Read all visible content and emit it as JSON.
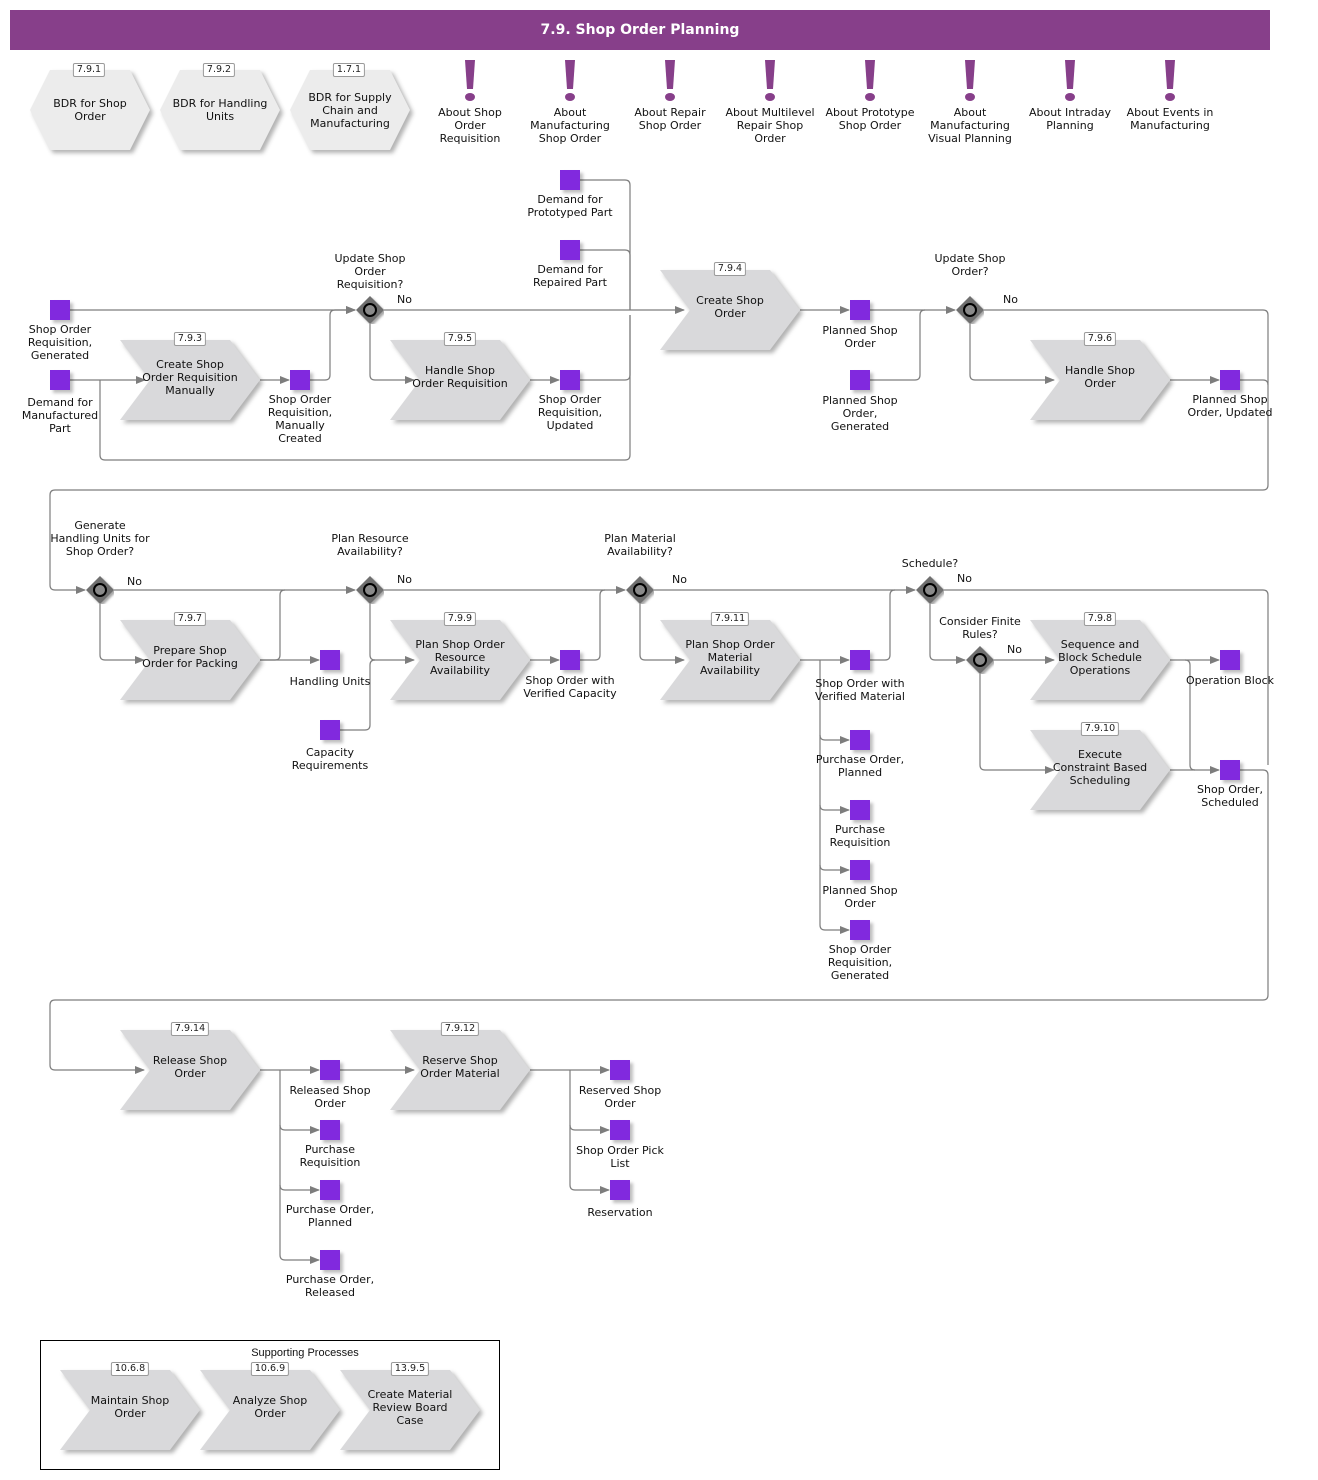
{
  "title": "7.9. Shop Order Planning",
  "colors": {
    "header": "#873f8a",
    "object": "#8129de",
    "process": "#d9d9db",
    "bdr": "#ececec",
    "gateway": "#7a7a7a",
    "connector": "#7d7d7d"
  },
  "bdr_items": [
    {
      "id": "7.9.1",
      "label": "BDR for Shop Order",
      "icon": "hexagon-shape"
    },
    {
      "id": "7.9.2",
      "label": "BDR for Handling Units",
      "icon": "hexagon-shape"
    },
    {
      "id": "1.7.1",
      "label": "BDR for Supply Chain and Manufacturing",
      "icon": "hexagon-shape"
    }
  ],
  "info_items": [
    {
      "label": "About Shop Order Requisition",
      "icon": "exclamation-icon"
    },
    {
      "label": "About Manufacturing Shop Order",
      "icon": "exclamation-icon"
    },
    {
      "label": "About Repair Shop Order",
      "icon": "exclamation-icon"
    },
    {
      "label": "About Multilevel Repair Shop Order",
      "icon": "exclamation-icon"
    },
    {
      "label": "About Prototype Shop Order",
      "icon": "exclamation-icon"
    },
    {
      "label": "About Manufacturing Visual Planning",
      "icon": "exclamation-icon"
    },
    {
      "label": "About Intraday Planning",
      "icon": "exclamation-icon"
    },
    {
      "label": "About Events in Manufacturing",
      "icon": "exclamation-icon"
    }
  ],
  "processes": {
    "p793": {
      "id": "7.9.3",
      "label": "Create Shop Order Requisition Manually"
    },
    "p795": {
      "id": "7.9.5",
      "label": "Handle Shop Order Requisition"
    },
    "p794": {
      "id": "7.9.4",
      "label": "Create Shop Order"
    },
    "p796": {
      "id": "7.9.6",
      "label": "Handle Shop Order"
    },
    "p797": {
      "id": "7.9.7",
      "label": "Prepare Shop Order for Packing"
    },
    "p799": {
      "id": "7.9.9",
      "label": "Plan Shop Order Resource Availability"
    },
    "p7911": {
      "id": "7.9.11",
      "label": "Plan Shop Order Material Availability"
    },
    "p798": {
      "id": "7.9.8",
      "label": "Sequence and Block Schedule Operations"
    },
    "p7910": {
      "id": "7.9.10",
      "label": "Execute Constraint Based Scheduling"
    },
    "p7914": {
      "id": "7.9.14",
      "label": "Release Shop Order"
    },
    "p7912": {
      "id": "7.9.12",
      "label": "Reserve Shop Order Material"
    }
  },
  "gateways": {
    "g1": {
      "question": "Update Shop Order Requisition?",
      "no_label": "No"
    },
    "g2": {
      "question": "Update Shop Order?",
      "no_label": "No"
    },
    "g3": {
      "question": "Generate Handling Units for Shop Order?",
      "no_label": "No"
    },
    "g4": {
      "question": "Plan Resource Availability?",
      "no_label": "No"
    },
    "g5": {
      "question": "Plan Material Availability?",
      "no_label": "No"
    },
    "g6": {
      "question": "Schedule?",
      "no_label": "No"
    },
    "g7": {
      "question": "Consider Finite Rules?",
      "no_label": "No"
    }
  },
  "objects": {
    "o_sor_gen": "Shop Order Requisition, Generated",
    "o_demand_mfg": "Demand for Manufactured Part",
    "o_sor_manual": "Shop Order Requisition, Manually Created",
    "o_demand_proto": "Demand for Prototyped Part",
    "o_demand_rep": "Demand for Repaired Part",
    "o_sor_updated": "Shop Order Requisition, Updated",
    "o_planned_so": "Planned Shop Order",
    "o_planned_so_gen": "Planned Shop Order, Generated",
    "o_planned_so_upd": "Planned Shop Order, Updated",
    "o_handling_units": "Handling Units",
    "o_capacity_req": "Capacity Requirements",
    "o_so_capacity": "Shop Order with Verified Capacity",
    "o_so_material": "Shop Order with Verified Material",
    "o_po_planned_1": "Purchase Order, Planned",
    "o_pr_1": "Purchase Requisition",
    "o_planned_so_2": "Planned Shop Order",
    "o_sor_gen_2": "Shop Order Requisition, Generated",
    "o_op_block": "Operation Block",
    "o_so_scheduled": "Shop Order, Scheduled",
    "o_released_so": "Released Shop Order",
    "o_pr_2": "Purchase Requisition",
    "o_po_planned_2": "Purchase Order, Planned",
    "o_po_released": "Purchase Order, Released",
    "o_reserved_so": "Reserved Shop Order",
    "o_pick_list": "Shop Order Pick List",
    "o_reservation": "Reservation"
  },
  "supporting": {
    "title": "Supporting Processes",
    "items": [
      {
        "id": "10.6.8",
        "label": "Maintain Shop Order"
      },
      {
        "id": "10.6.9",
        "label": "Analyze Shop Order"
      },
      {
        "id": "13.9.5",
        "label": "Create Material Review Board Case"
      }
    ]
  }
}
